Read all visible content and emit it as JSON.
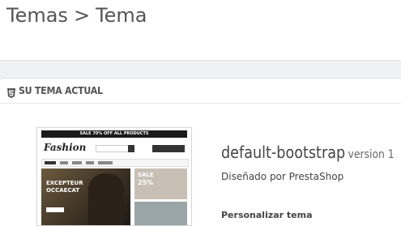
{
  "header": {
    "breadcrumb": [
      "Temas",
      "Tema"
    ],
    "separator": ">"
  },
  "panel": {
    "icon": "html5-icon",
    "title": "SU TEMA ACTUAL"
  },
  "preview": {
    "promo_bar": "SALE 70% OFF ALL PRODUCTS",
    "logo": "Fashion",
    "banner_line1": "EXCEPTEUR",
    "banner_line2": "OCCAECAT",
    "side_line1": "SALE",
    "side_line2": "25%"
  },
  "theme": {
    "name": "default-bootstrap",
    "version": "version 1",
    "designer": "Diseñado por PrestaShop",
    "customize_label": "Personalizar tema"
  }
}
